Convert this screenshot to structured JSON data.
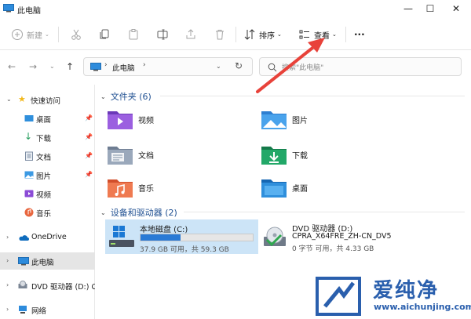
{
  "window": {
    "title": "此电脑",
    "controls": [
      "—",
      "☐",
      "✕"
    ]
  },
  "toolbar": {
    "new_label": "新建",
    "sort_label": "排序",
    "view_label": "查看",
    "more_label": "···"
  },
  "address": {
    "path": "此电脑",
    "search_placeholder": "搜索\"此电脑\""
  },
  "sidebar": {
    "quick_access": "快速访问",
    "items": [
      {
        "label": "桌面",
        "icon": "desktop-icon",
        "pinned": true
      },
      {
        "label": "下载",
        "icon": "download-icon",
        "pinned": true
      },
      {
        "label": "文档",
        "icon": "documents-icon",
        "pinned": true
      },
      {
        "label": "图片",
        "icon": "pictures-icon",
        "pinned": true
      },
      {
        "label": "视频",
        "icon": "videos-icon",
        "pinned": false
      },
      {
        "label": "音乐",
        "icon": "music-icon",
        "pinned": false
      }
    ],
    "onedrive": "OneDrive",
    "this_pc": "此电脑",
    "dvd": "DVD 驱动器 (D:) CI",
    "network": "网络"
  },
  "folders": {
    "header": "文件夹 (6)",
    "items": [
      {
        "label": "视频",
        "icon": "videos-folder-icon"
      },
      {
        "label": "图片",
        "icon": "pictures-folder-icon"
      },
      {
        "label": "文档",
        "icon": "documents-folder-icon"
      },
      {
        "label": "下载",
        "icon": "downloads-folder-icon"
      },
      {
        "label": "音乐",
        "icon": "music-folder-icon"
      },
      {
        "label": "桌面",
        "icon": "desktop-folder-icon"
      }
    ]
  },
  "drives": {
    "header": "设备和驱动器 (2)",
    "items": [
      {
        "name": "本地磁盘 (C:)",
        "sub": "",
        "usage": "37.9 GB 可用，共 59.3 GB",
        "used_fraction": 0.36
      },
      {
        "name": "DVD 驱动器 (D:)",
        "sub": "CPRA_X64FRE_ZH-CN_DV5",
        "usage": "0 字节 可用，共 4.33 GB",
        "used_fraction": 1.0
      }
    ]
  },
  "watermark": {
    "text": "爱纯净",
    "url": "www.aichunjing.com"
  },
  "colors": {
    "accent": "#2a7ad5",
    "selection": "#cce4f7",
    "arrow": "#e8423a",
    "header_text": "#1e4f91"
  }
}
